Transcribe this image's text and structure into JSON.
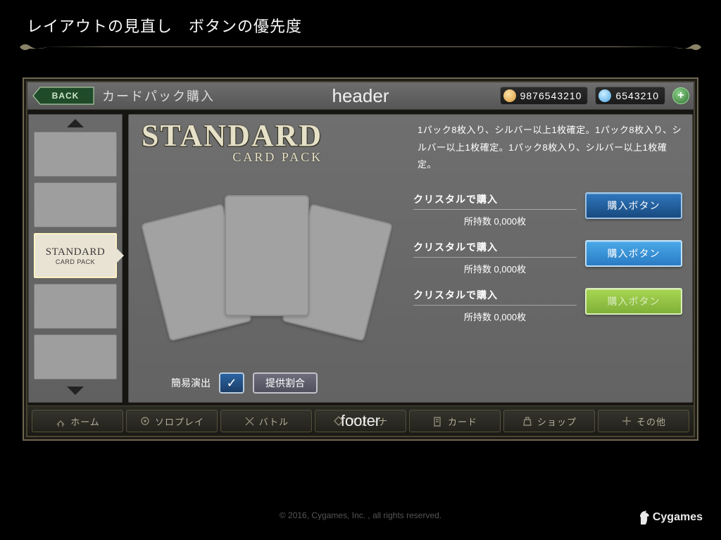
{
  "slide": {
    "title": "レイアウトの見直し　ボタンの優先度"
  },
  "header": {
    "back_label": "BACK",
    "title": "カードパック購入",
    "overlay_label": "header",
    "currency1_value": "9876543210",
    "currency2_value": "6543210",
    "currency1_color": "#d89b3a",
    "currency2_color": "#4aa9e8",
    "add_label": "+"
  },
  "sidebar": {
    "selected_index": 2,
    "selected_title": "STANDARD",
    "selected_subtitle": "CARD PACK"
  },
  "pack": {
    "title": "STANDARD",
    "subtitle": "CARD PACK",
    "description": "1パック8枚入り、シルバー以上1枚確定。1パック8枚入り、シルバー以上1枚確定。1パック8枚入り、シルバー以上1枚確定。",
    "simple_label": "簡易演出",
    "rate_label": "提供割合",
    "purchase_rows": [
      {
        "title": "クリスタルで購入",
        "sub": "所持数 0,000枚",
        "button": "購入ボタン"
      },
      {
        "title": "クリスタルで購入",
        "sub": "所持数 0,000枚",
        "button": "購入ボタン"
      },
      {
        "title": "クリスタルで購入",
        "sub": "所持数 0,000枚",
        "button": "購入ボタン"
      }
    ]
  },
  "footer": {
    "overlay_label": "footer",
    "items": [
      {
        "label": "ホーム"
      },
      {
        "label": "ソロプレイ"
      },
      {
        "label": "バトル"
      },
      {
        "label": "アリーナ"
      },
      {
        "label": "カード"
      },
      {
        "label": "ショップ"
      },
      {
        "label": "その他"
      }
    ]
  },
  "copyright": "© 2016, Cygames, Inc. , all rights reserved.",
  "brand": "Cygames"
}
